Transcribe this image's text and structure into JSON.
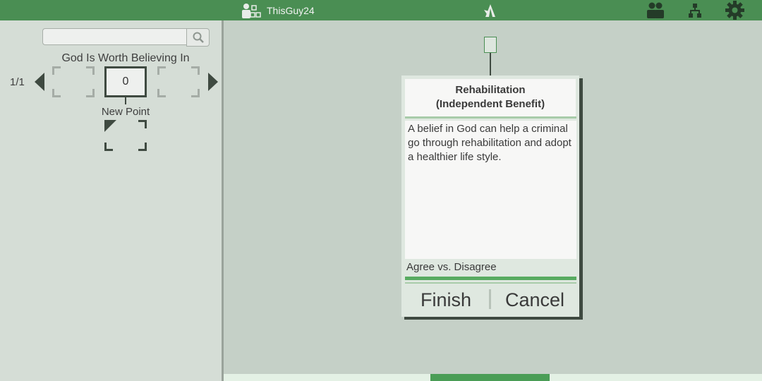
{
  "header": {
    "username": "ThisGuy24",
    "icons": [
      "user-group-icon",
      "logo-icon",
      "people-icon",
      "hierarchy-icon",
      "gear-icon"
    ]
  },
  "sidebar": {
    "search": {
      "placeholder": "",
      "value": ""
    },
    "topic_title": "God Is Worth Believing In",
    "page_indicator": "1/1",
    "score": "0",
    "new_point_label": "New Point"
  },
  "card": {
    "title_line1": "Rehabilitation",
    "title_line2": "(Independent Benefit)",
    "body": "A belief in God can help a criminal go through rehabilitation and adopt a healthier life style.",
    "type_label": "Agree vs. Disagree",
    "finish_label": "Finish",
    "cancel_label": "Cancel"
  },
  "colors": {
    "header": "#4a8e53",
    "background": "#c5d0c7",
    "panel": "#d5ddd6",
    "accent_green": "#58ab61",
    "dark": "#3f4a41"
  }
}
